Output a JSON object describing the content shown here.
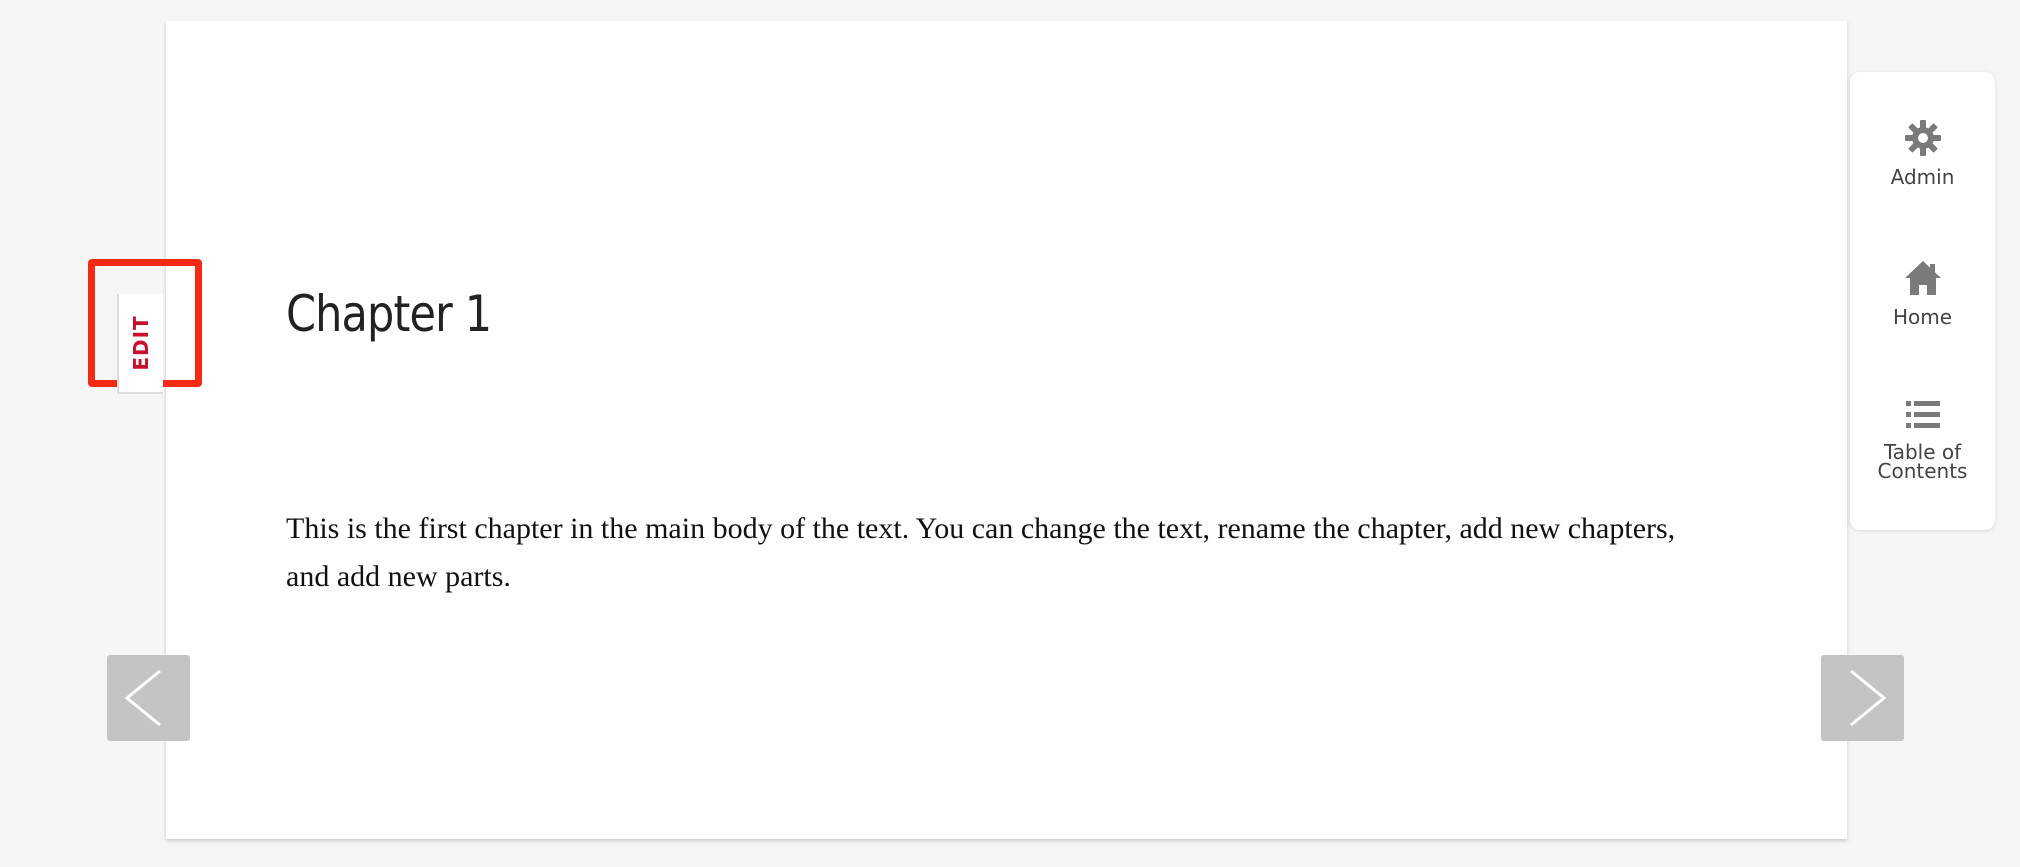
{
  "side_panel": {
    "items": [
      {
        "label": "Admin",
        "icon": "gear-icon"
      },
      {
        "label": "Home",
        "icon": "home-icon"
      },
      {
        "label_line1": "Table of",
        "label_line2": "Contents",
        "icon": "list-icon"
      }
    ]
  },
  "edit_tab": {
    "label": "EDIT"
  },
  "chapter": {
    "title": "Chapter 1",
    "body": "This is the first chapter in the main body of the text. You can change the text, rename the chapter, add new chapters, and add new parts."
  },
  "navigation": {
    "prev_icon": "chevron-left-icon",
    "next_icon": "chevron-right-icon"
  },
  "colors": {
    "edit_text": "#c8102e",
    "highlight": "#f52a14",
    "nav_button": "#c4c4c4",
    "icon_gray": "#7a7a7a"
  }
}
